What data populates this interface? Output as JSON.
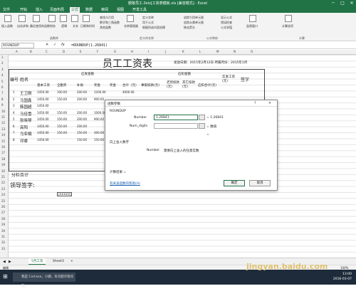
{
  "window": {
    "title": "额敬员工.0xls[工资表模板.xls [兼容模式] - Excel",
    "minimize": "─",
    "restore": "□",
    "close": "✕"
  },
  "menu_tabs": [
    "文件",
    "开始",
    "插入",
    "页面布局",
    "公式",
    "数据",
    "审阅",
    "视图",
    "开发工具"
  ],
  "ribbon": {
    "buttons": [
      "插入函数",
      "自动求和",
      "最近使用的函数",
      "财务",
      "逻辑",
      "文本",
      "日期和时间",
      "查找与引用",
      "数学和三角函数",
      "其他函数",
      "名称管理器",
      "定义名称",
      "用于公式",
      "根据所选内容创建",
      "追踪引用单元格",
      "追踪从属单元格",
      "移去箭头",
      "显示公式",
      "错误检查",
      "公式求值",
      "监视窗口",
      "计算选项"
    ],
    "groups": [
      "函数库",
      "定义的名称",
      "公式审核",
      "计算"
    ]
  },
  "formula_bar": {
    "name_box": "ROUNDUP",
    "fx": "fx",
    "cancel": "✕",
    "enter": "✓",
    "formula": "=ROUNDUP(1.26841)"
  },
  "columns": [
    "A",
    "B",
    "C",
    "D",
    "E",
    "F",
    "G",
    "H",
    "I",
    "J",
    "K",
    "L",
    "M",
    "N",
    "O"
  ],
  "rows": [
    "1",
    "2",
    "3",
    "4",
    "5",
    "6",
    "7",
    "8",
    "9",
    "10",
    "11",
    "12",
    "13",
    "14",
    "15",
    "16",
    "17",
    "18",
    "19",
    "20",
    "21",
    "22",
    "23",
    "24",
    "25",
    "26",
    "27",
    "28",
    "29",
    "30",
    "31",
    "32",
    "33"
  ],
  "sheet": {
    "title": "员工工资表",
    "date_label": "发放日期：2015年2月12日  所属月份：2015年1月",
    "col_headers": {
      "num": "编号",
      "name": "姓名",
      "payable_group": "应发金额",
      "deduct_group": "应扣金额",
      "base": "基本工资",
      "full": "全勤奖",
      "subsidy": "补助",
      "bonus": "奖金",
      "award": "奖金",
      "total": "合计（元）",
      "leave": "事假扣款(元)",
      "absent": "迟到扣款(元)",
      "other": "其它扣款(元)",
      "deduct_total": "应扣合计(元)",
      "actual": "实发工资(元)",
      "sign": "签字"
    },
    "employees": [
      {
        "no": "1",
        "name": "王卫刚",
        "base": "1450.00",
        "full": "100.00",
        "subsidy": "200.00",
        "bonus": "1200.00",
        "total": "4000.00"
      },
      {
        "no": "2",
        "name": "马国鑫",
        "base": "1450.00",
        "full": "150.00",
        "subsidy": "200.00",
        "bonus": "900.00",
        "total": ""
      },
      {
        "no": "3",
        "name": "韩国超",
        "base": "1450.00",
        "full": "",
        "subsidy": "",
        "bonus": "",
        "total": ""
      },
      {
        "no": "4",
        "name": "马佳雪",
        "base": "1450.00",
        "full": "150.00",
        "subsidy": "200.00",
        "bonus": "1000.00",
        "total": ""
      },
      {
        "no": "5",
        "name": "张晓琴",
        "base": "1450.00",
        "full": "150.00",
        "subsidy": "200.00",
        "bonus": "900.00",
        "total": ""
      },
      {
        "no": "6",
        "name": "高阳",
        "base": "1450.00",
        "full": "150.00",
        "subsidy": "200.00",
        "bonus": "",
        "total": ""
      },
      {
        "no": "7",
        "name": "马亚娟",
        "base": "1450.00",
        "full": "150.00",
        "subsidy": "150.00",
        "bonus": "300.00",
        "total": ""
      },
      {
        "no": "8",
        "name": "邓睿",
        "base": "1450.00",
        "full": "",
        "subsidy": "150.00",
        "bonus": "150.00",
        "total": ""
      }
    ],
    "subtotal_label": "分栏合计",
    "sign_label": "领导签字:",
    "cell_tag": "[#####]"
  },
  "dialog": {
    "title": "函数参数",
    "help": "?",
    "close": "✕",
    "function_name": "ROUNDUP",
    "arg1_label": "Number",
    "arg1_value": "1.26841",
    "arg1_result": "= 1.26841",
    "arg2_label": "Num_digits",
    "arg2_value": "",
    "arg2_result": "= 数值",
    "equals": "=",
    "description": "向上舍入数字",
    "arg_desc_label": "Number",
    "arg_desc": "需要向上舍入的任意实数",
    "result_label": "计算结果 =",
    "help_link": "有关该函数的帮助(H)",
    "ok": "确定",
    "cancel": "取消"
  },
  "sheet_tabs": [
    "5月工资",
    "Sheet3"
  ],
  "add_sheet": "+",
  "status_left": "编辑",
  "zoom": "100%",
  "taskbar": {
    "search": "我是 Cortana，小娜。有问题尽管问我。",
    "time": "13:00",
    "date": "2016-03-07"
  },
  "watermark": "jingyan.baidu.com"
}
